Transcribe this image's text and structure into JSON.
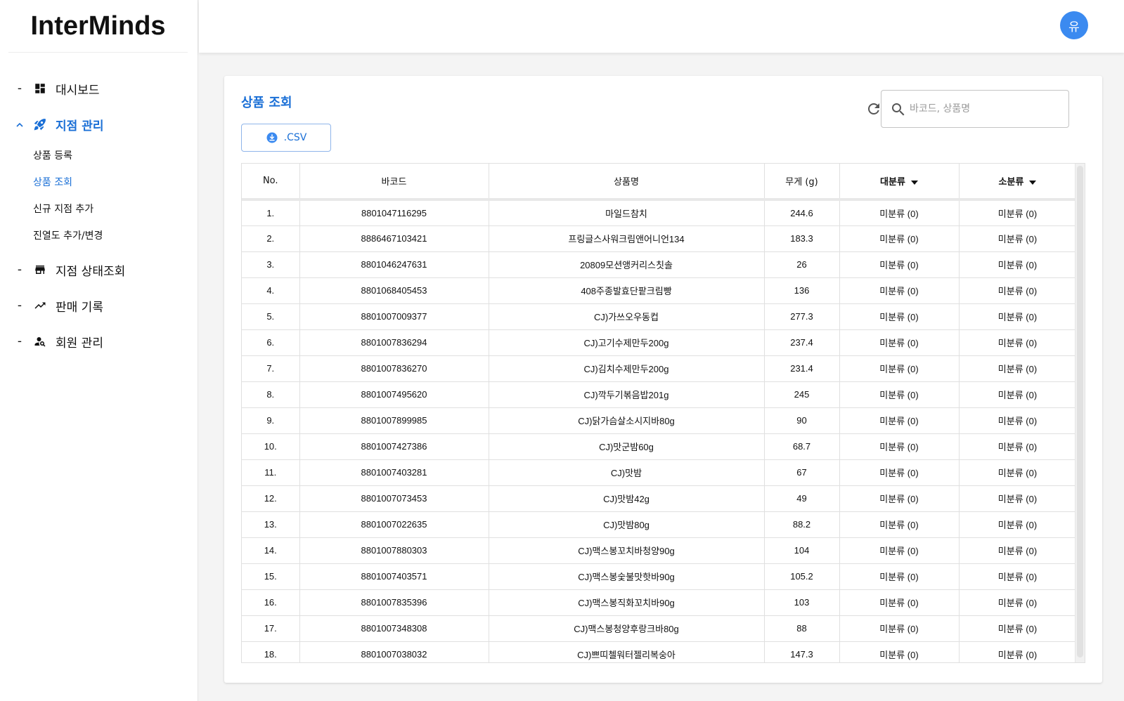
{
  "app": {
    "logo": "InterMinds"
  },
  "user": {
    "avatar_initial": "유"
  },
  "sidebar": {
    "items": [
      {
        "marker": "-",
        "label": "대시보드",
        "icon": "dashboard-icon"
      },
      {
        "marker": "^",
        "label": "지점 관리",
        "icon": "rocket-icon",
        "active": true
      },
      {
        "marker": "-",
        "label": "지점 상태조회",
        "icon": "store-icon"
      },
      {
        "marker": "-",
        "label": "판매 기록",
        "icon": "trending-up-icon"
      },
      {
        "marker": "-",
        "label": "회원 관리",
        "icon": "person-search-icon"
      }
    ],
    "subitems": [
      {
        "label": "상품 등록"
      },
      {
        "label": "상품 조회",
        "active": true
      },
      {
        "label": "신규 지점 추가"
      },
      {
        "label": "진열도 추가/변경"
      }
    ]
  },
  "page": {
    "title": "상품 조회",
    "csv_label": ".CSV",
    "search_placeholder": "바코드, 상품명"
  },
  "table": {
    "headers": [
      "No.",
      "바코드",
      "상품명",
      "무게 (g)",
      "대분류",
      "소분류"
    ],
    "rows": [
      [
        "1.",
        "8801047116295",
        "마일드참치",
        "244.6",
        "미분류 (0)",
        "미분류 (0)"
      ],
      [
        "2.",
        "8886467103421",
        "프링글스사워크림앤어니언134",
        "183.3",
        "미분류 (0)",
        "미분류 (0)"
      ],
      [
        "3.",
        "8801046247631",
        "20809모션앵커리스칫솔",
        "26",
        "미분류 (0)",
        "미분류 (0)"
      ],
      [
        "4.",
        "8801068405453",
        "408주종발효단팥크림빵",
        "136",
        "미분류 (0)",
        "미분류 (0)"
      ],
      [
        "5.",
        "8801007009377",
        "CJ)가쓰오우동컵",
        "277.3",
        "미분류 (0)",
        "미분류 (0)"
      ],
      [
        "6.",
        "8801007836294",
        "CJ)고기수제만두200g",
        "237.4",
        "미분류 (0)",
        "미분류 (0)"
      ],
      [
        "7.",
        "8801007836270",
        "CJ)김치수제만두200g",
        "231.4",
        "미분류 (0)",
        "미분류 (0)"
      ],
      [
        "8.",
        "8801007495620",
        "CJ)깍두기볶음밥201g",
        "245",
        "미분류 (0)",
        "미분류 (0)"
      ],
      [
        "9.",
        "8801007899985",
        "CJ)닭가슴살소시지바80g",
        "90",
        "미분류 (0)",
        "미분류 (0)"
      ],
      [
        "10.",
        "8801007427386",
        "CJ)맛군밤60g",
        "68.7",
        "미분류 (0)",
        "미분류 (0)"
      ],
      [
        "11.",
        "8801007403281",
        "CJ)맛밤",
        "67",
        "미분류 (0)",
        "미분류 (0)"
      ],
      [
        "12.",
        "8801007073453",
        "CJ)맛밤42g",
        "49",
        "미분류 (0)",
        "미분류 (0)"
      ],
      [
        "13.",
        "8801007022635",
        "CJ)맛밤80g",
        "88.2",
        "미분류 (0)",
        "미분류 (0)"
      ],
      [
        "14.",
        "8801007880303",
        "CJ)맥스봉꼬치바청양90g",
        "104",
        "미분류 (0)",
        "미분류 (0)"
      ],
      [
        "15.",
        "8801007403571",
        "CJ)맥스봉숯불맛핫바90g",
        "105.2",
        "미분류 (0)",
        "미분류 (0)"
      ],
      [
        "16.",
        "8801007835396",
        "CJ)맥스봉직화꼬치바90g",
        "103",
        "미분류 (0)",
        "미분류 (0)"
      ],
      [
        "17.",
        "8801007348308",
        "CJ)맥스봉청양후랑크바80g",
        "88",
        "미분류 (0)",
        "미분류 (0)"
      ],
      [
        "18.",
        "8801007038032",
        "CJ)쁘띠첼워터젤리복숭아",
        "147.3",
        "미분류 (0)",
        "미분류 (0)"
      ]
    ]
  }
}
